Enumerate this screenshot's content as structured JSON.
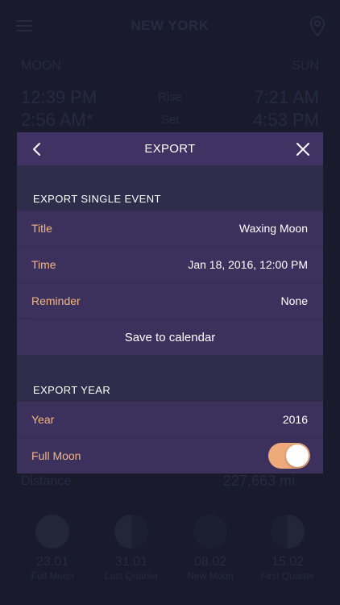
{
  "background": {
    "city": "NEW YORK",
    "moon_label": "MOON",
    "sun_label": "SUN",
    "moon_rise": "12:39 PM",
    "rise_label": "Rise",
    "sun_rise": "7:21 AM",
    "moon_set": "2:56 AM*",
    "set_label": "Set",
    "sun_set": "4:53 PM",
    "distance_label": "Distance",
    "distance_value": "227,663 mi",
    "phases": [
      {
        "date": "23.01",
        "name": "Full Moon"
      },
      {
        "date": "31.01",
        "name": "Last Quarter"
      },
      {
        "date": "08.02",
        "name": "New Moon"
      },
      {
        "date": "15.02",
        "name": "First Quarter"
      }
    ]
  },
  "modal": {
    "title": "EXPORT",
    "single_section": "EXPORT SINGLE EVENT",
    "rows": [
      {
        "label": "Title",
        "value": "Waxing Moon"
      },
      {
        "label": "Time",
        "value": "Jan 18, 2016, 12:00 PM"
      },
      {
        "label": "Reminder",
        "value": "None"
      }
    ],
    "save_label": "Save to calendar",
    "year_section": "EXPORT YEAR",
    "year_label": "Year",
    "year_value": "2016",
    "fullmoon_label": "Full Moon",
    "fullmoon_on": true
  },
  "colors": {
    "accent": "#f2b586",
    "toggle_on": "#eeaa7b",
    "modal_bg": "#302c4c",
    "row_bg": "#3c315d"
  }
}
